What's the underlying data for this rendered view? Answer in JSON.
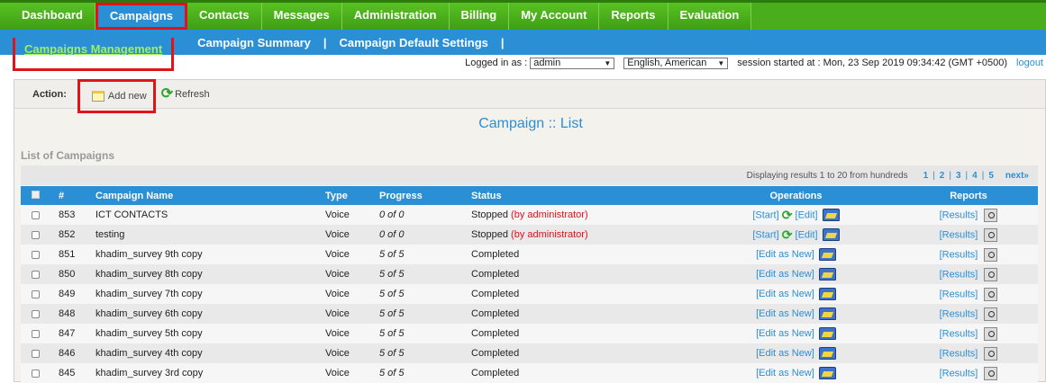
{
  "top_nav": [
    "Dashboard",
    "Campaigns",
    "Contacts",
    "Messages",
    "Administration",
    "Billing",
    "My Account",
    "Reports",
    "Evaluation"
  ],
  "top_nav_active": "Campaigns",
  "sub_nav": {
    "active": "Campaigns Management",
    "items": [
      "Campaign Summary",
      "Campaign Default Settings"
    ],
    "sep": "|"
  },
  "session": {
    "logged_in_label": "Logged in as :",
    "user": "admin",
    "language": "English, American",
    "session_text": "session started at : Mon, 23 Sep 2019 09:34:42 (GMT +0500)",
    "logout": "logout"
  },
  "action_bar": {
    "label": "Action:",
    "add_new": "Add new",
    "refresh": "Refresh"
  },
  "page_title": "Campaign :: List",
  "list_label": "List of Campaigns",
  "pager": {
    "info": "Displaying results 1 to 20 from hundreds",
    "pages": [
      "1",
      "2",
      "3",
      "4",
      "5"
    ],
    "next": "next»"
  },
  "table": {
    "headers": [
      "#",
      "Campaign Name",
      "Type",
      "Progress",
      "Status",
      "Operations",
      "Reports"
    ],
    "rows": [
      {
        "id": "853",
        "name": "ICT CONTACTS",
        "type": "Voice",
        "progress": "0 of 0",
        "status": "Stopped",
        "status_note": "(by administrator)",
        "ops": "start"
      },
      {
        "id": "852",
        "name": "testing",
        "type": "Voice",
        "progress": "0 of 0",
        "status": "Stopped",
        "status_note": "(by administrator)",
        "ops": "start"
      },
      {
        "id": "851",
        "name": "khadim_survey 9th copy",
        "type": "Voice",
        "progress": "5 of 5",
        "status": "Completed",
        "status_note": "",
        "ops": "editnew"
      },
      {
        "id": "850",
        "name": "khadim_survey 8th copy",
        "type": "Voice",
        "progress": "5 of 5",
        "status": "Completed",
        "status_note": "",
        "ops": "editnew"
      },
      {
        "id": "849",
        "name": "khadim_survey 7th copy",
        "type": "Voice",
        "progress": "5 of 5",
        "status": "Completed",
        "status_note": "",
        "ops": "editnew"
      },
      {
        "id": "848",
        "name": "khadim_survey 6th copy",
        "type": "Voice",
        "progress": "5 of 5",
        "status": "Completed",
        "status_note": "",
        "ops": "editnew"
      },
      {
        "id": "847",
        "name": "khadim_survey 5th copy",
        "type": "Voice",
        "progress": "5 of 5",
        "status": "Completed",
        "status_note": "",
        "ops": "editnew"
      },
      {
        "id": "846",
        "name": "khadim_survey 4th copy",
        "type": "Voice",
        "progress": "5 of 5",
        "status": "Completed",
        "status_note": "",
        "ops": "editnew"
      },
      {
        "id": "845",
        "name": "khadim_survey 3rd copy",
        "type": "Voice",
        "progress": "5 of 5",
        "status": "Completed",
        "status_note": "",
        "ops": "editnew"
      }
    ],
    "op_labels": {
      "start": "[Start]",
      "edit": "[Edit]",
      "edit_new": "[Edit as New]",
      "results": "[Results]"
    }
  },
  "colors": {
    "nav_green": "#4aae1c",
    "nav_blue": "#2b8fd6",
    "highlight_red": "#e0121a"
  },
  "icons": [
    "note-icon",
    "refresh-icon",
    "folder-icon",
    "magnifier-icon",
    "checkbox"
  ]
}
